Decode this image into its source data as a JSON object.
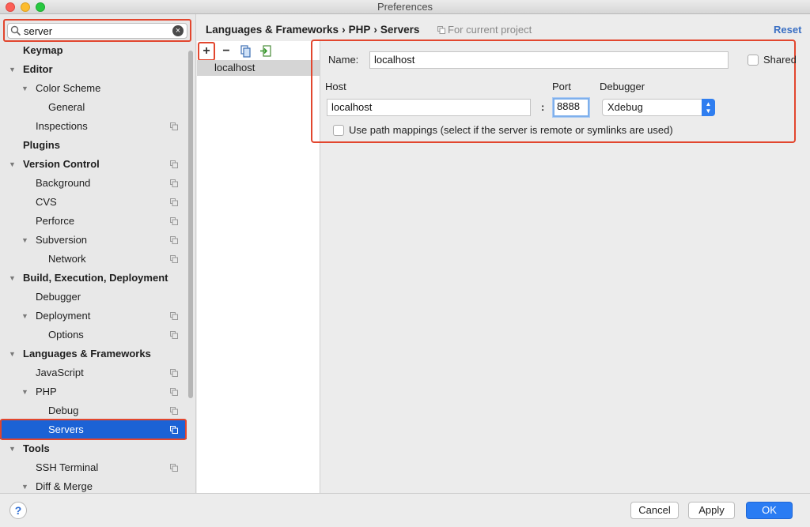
{
  "window": {
    "title": "Preferences"
  },
  "search": {
    "value": "server",
    "clear_icon": "×"
  },
  "sidebar": {
    "items": [
      {
        "label": "Keymap",
        "level": 0,
        "bold": true,
        "arrow": "",
        "project": false
      },
      {
        "label": "Editor",
        "level": 0,
        "bold": true,
        "arrow": "▼",
        "project": false
      },
      {
        "label": "Color Scheme",
        "level": 1,
        "bold": false,
        "arrow": "▼",
        "project": false
      },
      {
        "label": "General",
        "level": 2,
        "bold": false,
        "arrow": "",
        "project": false
      },
      {
        "label": "Inspections",
        "level": 1,
        "bold": false,
        "arrow": "",
        "project": true
      },
      {
        "label": "Plugins",
        "level": 0,
        "bold": true,
        "arrow": "",
        "project": false
      },
      {
        "label": "Version Control",
        "level": 0,
        "bold": true,
        "arrow": "▼",
        "project": true
      },
      {
        "label": "Background",
        "level": 1,
        "bold": false,
        "arrow": "",
        "project": true
      },
      {
        "label": "CVS",
        "level": 1,
        "bold": false,
        "arrow": "",
        "project": true
      },
      {
        "label": "Perforce",
        "level": 1,
        "bold": false,
        "arrow": "",
        "project": true
      },
      {
        "label": "Subversion",
        "level": 1,
        "bold": false,
        "arrow": "▼",
        "project": true
      },
      {
        "label": "Network",
        "level": 2,
        "bold": false,
        "arrow": "",
        "project": true
      },
      {
        "label": "Build, Execution, Deployment",
        "level": 0,
        "bold": true,
        "arrow": "▼",
        "project": false
      },
      {
        "label": "Debugger",
        "level": 1,
        "bold": false,
        "arrow": "",
        "project": false
      },
      {
        "label": "Deployment",
        "level": 1,
        "bold": false,
        "arrow": "▼",
        "project": true
      },
      {
        "label": "Options",
        "level": 2,
        "bold": false,
        "arrow": "",
        "project": true
      },
      {
        "label": "Languages & Frameworks",
        "level": 0,
        "bold": true,
        "arrow": "▼",
        "project": false
      },
      {
        "label": "JavaScript",
        "level": 1,
        "bold": false,
        "arrow": "",
        "project": true
      },
      {
        "label": "PHP",
        "level": 1,
        "bold": false,
        "arrow": "▼",
        "project": true
      },
      {
        "label": "Debug",
        "level": 2,
        "bold": false,
        "arrow": "",
        "project": true
      },
      {
        "label": "Servers",
        "level": 2,
        "bold": false,
        "arrow": "",
        "project": true,
        "selected": true
      },
      {
        "label": "Tools",
        "level": 0,
        "bold": true,
        "arrow": "▼",
        "project": false
      },
      {
        "label": "SSH Terminal",
        "level": 1,
        "bold": false,
        "arrow": "",
        "project": true
      },
      {
        "label": "Diff & Merge",
        "level": 1,
        "bold": false,
        "arrow": "▼",
        "project": false
      }
    ]
  },
  "header": {
    "breadcrumb": [
      "Languages & Frameworks",
      "PHP",
      "Servers"
    ],
    "separator": "›",
    "scope": "For current project",
    "reset": "Reset"
  },
  "servers_list": {
    "toolbar": {
      "add": "+",
      "remove": "−"
    },
    "items": [
      "localhost"
    ]
  },
  "server_form": {
    "name_label": "Name:",
    "name_value": "localhost",
    "shared_label": "Shared",
    "host_label": "Host",
    "host_value": "localhost",
    "port_label": "Port",
    "colon": ":",
    "port_value": "8888",
    "debugger_label": "Debugger",
    "debugger_value": "Xdebug",
    "path_mappings_label": "Use path mappings (select if the server is remote or symlinks are used)"
  },
  "footer": {
    "help": "?",
    "cancel": "Cancel",
    "apply": "Apply",
    "ok": "OK"
  },
  "colors": {
    "selection": "#1c62d5",
    "highlight": "#e2462e",
    "primary_button": "#2a7cf3",
    "link": "#3a6fc3"
  }
}
